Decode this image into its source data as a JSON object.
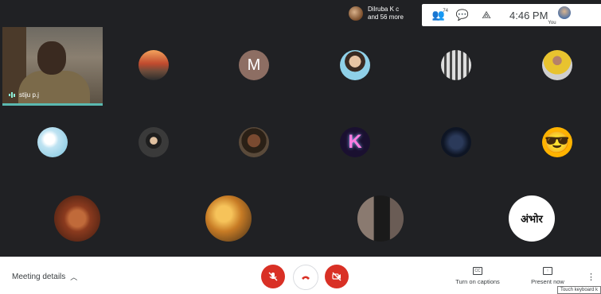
{
  "topbar": {
    "presenter_line1": "Dilruba K c",
    "presenter_line2": "and 56 more",
    "participants_count": "74",
    "time": "4:46 PM",
    "self_label": "You"
  },
  "self_tile": {
    "name": "stiju p.j"
  },
  "participants": [
    {
      "id": "p1",
      "kind": "photo",
      "label": ""
    },
    {
      "id": "p2",
      "kind": "letter",
      "label": "M"
    },
    {
      "id": "p3",
      "kind": "photo",
      "label": ""
    },
    {
      "id": "p4",
      "kind": "photo",
      "label": ""
    },
    {
      "id": "p5",
      "kind": "photo",
      "label": ""
    },
    {
      "id": "p6",
      "kind": "photo",
      "label": ""
    },
    {
      "id": "p7",
      "kind": "photo",
      "label": ""
    },
    {
      "id": "p8",
      "kind": "photo",
      "label": ""
    },
    {
      "id": "p9",
      "kind": "letter",
      "label": "K"
    },
    {
      "id": "p10",
      "kind": "photo",
      "label": ""
    },
    {
      "id": "p11",
      "kind": "emoji",
      "label": "😎"
    },
    {
      "id": "p12",
      "kind": "photo",
      "label": ""
    },
    {
      "id": "p13",
      "kind": "photo",
      "label": ""
    },
    {
      "id": "p14",
      "kind": "photo",
      "label": ""
    },
    {
      "id": "p15",
      "kind": "text-logo",
      "label": "अंभोर"
    }
  ],
  "bottombar": {
    "meeting_details": "Meeting details",
    "captions_label": "Turn on captions",
    "captions_icon": "CC",
    "present_label": "Present now",
    "tooltip": "Touch keyboard k"
  }
}
